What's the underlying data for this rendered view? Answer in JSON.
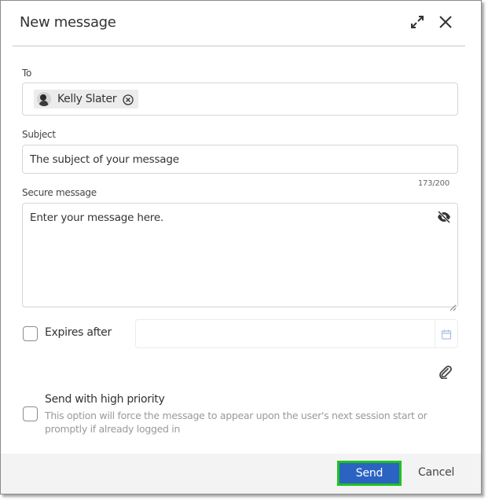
{
  "dialog": {
    "title": "New message",
    "expand_icon": "expand-icon",
    "close_icon": "close-icon"
  },
  "to": {
    "label": "To",
    "recipients": [
      {
        "name": "Kelly Slater",
        "avatar": "user-avatar",
        "remove_icon": "circle-x-icon"
      }
    ]
  },
  "subject": {
    "label": "Subject",
    "value": "The subject of your message",
    "counter": "173/200"
  },
  "message": {
    "label": "Secure message",
    "placeholder": "Enter your message here.",
    "visibility_icon": "eye-slash-icon"
  },
  "expires": {
    "label": "Expires after",
    "checked": false,
    "date_value": "",
    "calendar_icon": "calendar-icon"
  },
  "attachment": {
    "icon": "paperclip-icon"
  },
  "priority": {
    "label": "Send with high priority",
    "checked": false,
    "hint": "This option will force the message to appear upon the user's next session start or promptly if already logged in"
  },
  "footer": {
    "send_label": "Send",
    "cancel_label": "Cancel",
    "send_color": "#2b63c3",
    "highlight_color": "#1fc21f"
  }
}
